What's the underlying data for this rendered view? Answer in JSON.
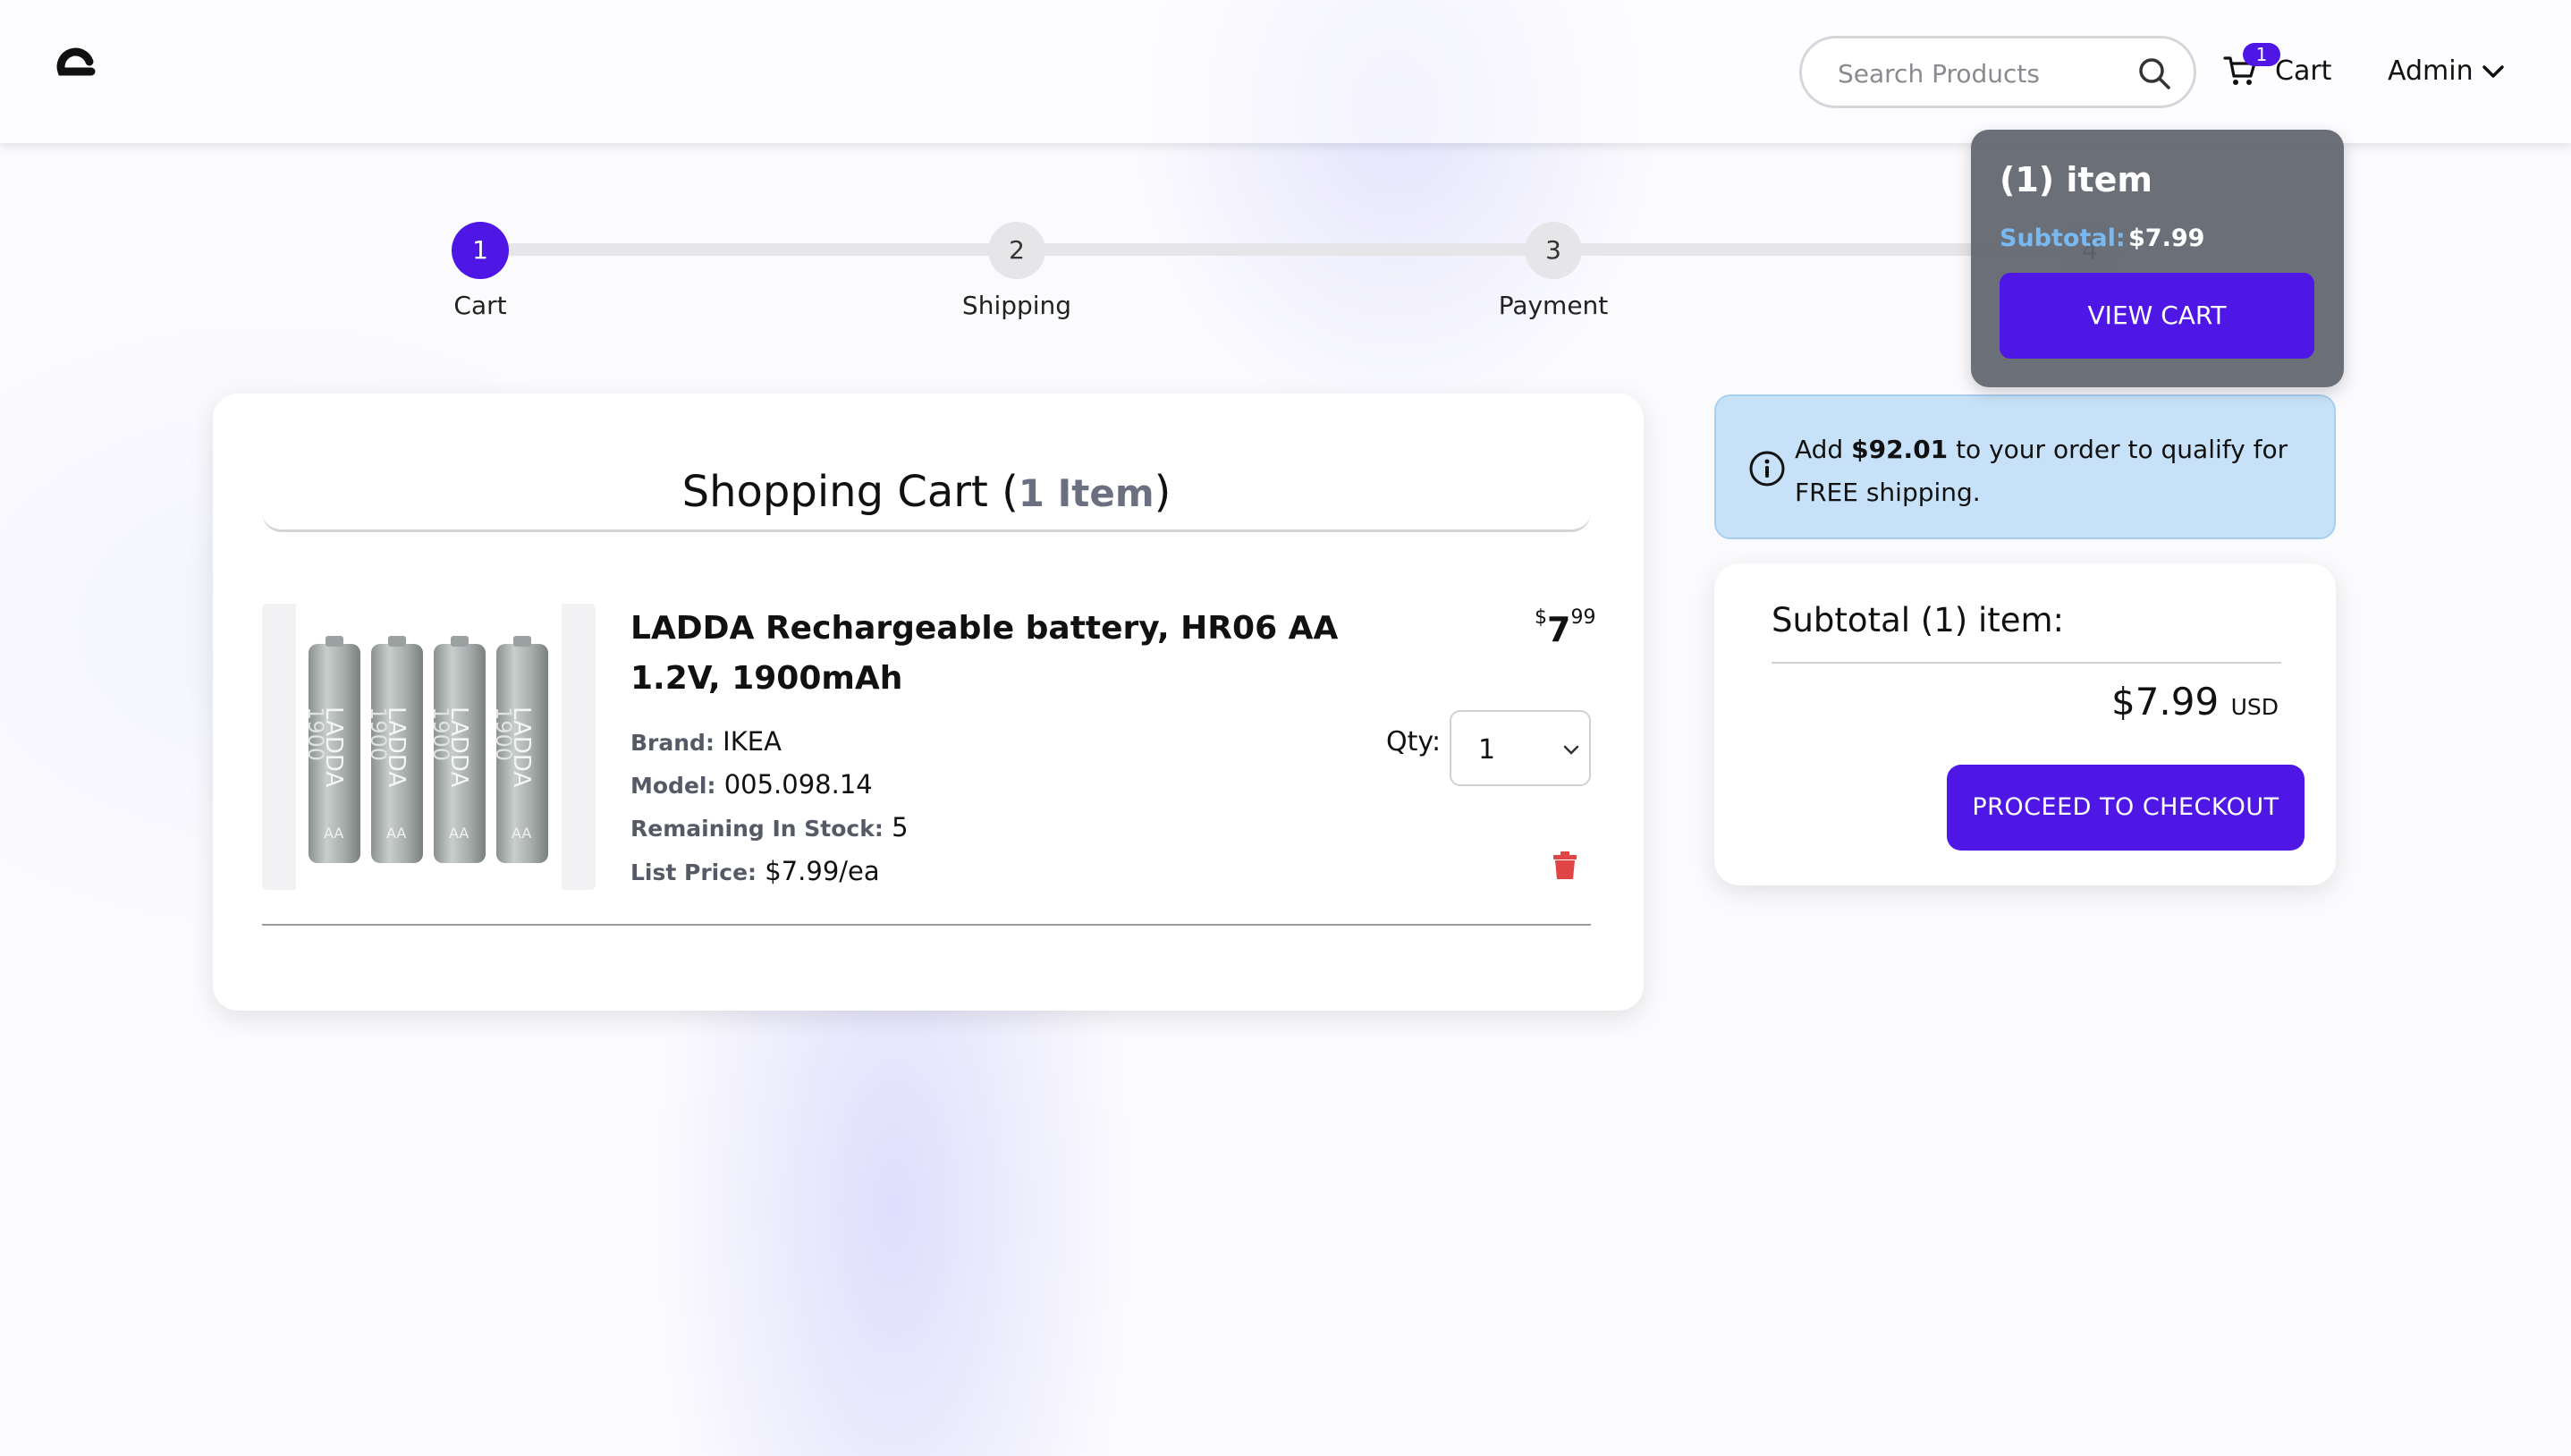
{
  "header": {
    "search_placeholder": "Search Products",
    "cart_badge": "1",
    "cart_label": "Cart",
    "user_label": "Admin"
  },
  "stepper": {
    "steps": [
      {
        "number": "1",
        "label": "Cart",
        "active": true
      },
      {
        "number": "2",
        "label": "Shipping",
        "active": false
      },
      {
        "number": "3",
        "label": "Payment",
        "active": false
      },
      {
        "number": "4",
        "label": "",
        "active": false
      }
    ]
  },
  "cart": {
    "title": "Shopping Cart (",
    "count_text": "1 Item",
    "title_close": ")",
    "item": {
      "name": "LADDA Rechargeable battery, HR06 AA 1.2V, 1900mAh",
      "price_currency": "$",
      "price_whole": "7",
      "price_cents": "99",
      "brand_label": "Brand:",
      "brand": "IKEA",
      "model_label": "Model:",
      "model": "005.098.14",
      "stock_label": "Remaining In Stock:",
      "stock": "5",
      "list_price_label": "List Price:",
      "list_price": "$7.99/ea",
      "qty_label": "Qty:",
      "qty_value": "1",
      "image_text": "LADDA",
      "image_subtext": "1900",
      "image_badge": "AA"
    }
  },
  "shipping_notice": {
    "prefix": "Add ",
    "amount": "$92.01",
    "suffix": " to your order to qualify for FREE shipping."
  },
  "summary": {
    "subtotal_label": "Subtotal (1) item:",
    "total": "$7.99",
    "currency": "USD",
    "checkout_label": "PROCEED TO CHECKOUT"
  },
  "mini_cart": {
    "items_label": "(1) item",
    "subtotal_label": "Subtotal:",
    "subtotal_value": "$7.99",
    "view_cart_label": "VIEW CART"
  },
  "colors": {
    "accent": "#4f17e6",
    "info_bg": "#c7e2f8",
    "popover_bg": "#5f646e",
    "trash": "#e04545"
  }
}
